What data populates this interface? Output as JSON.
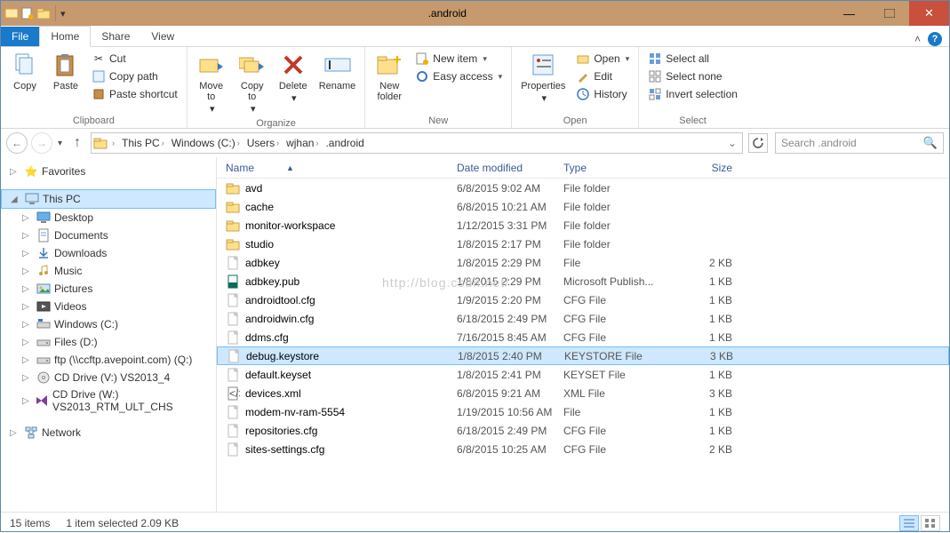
{
  "window": {
    "title": ".android"
  },
  "tabs": {
    "file": "File",
    "home": "Home",
    "share": "Share",
    "view": "View"
  },
  "ribbon": {
    "clipboard": {
      "copy": "Copy",
      "paste": "Paste",
      "cut": "Cut",
      "copypath": "Copy path",
      "pasteshortcut": "Paste shortcut",
      "label": "Clipboard"
    },
    "organize": {
      "moveto": "Move\nto",
      "copyto": "Copy\nto",
      "delete": "Delete",
      "rename": "Rename",
      "label": "Organize"
    },
    "new": {
      "newfolder": "New\nfolder",
      "newitem": "New item",
      "easyaccess": "Easy access",
      "label": "New"
    },
    "open": {
      "properties": "Properties",
      "open": "Open",
      "edit": "Edit",
      "history": "History",
      "label": "Open"
    },
    "select": {
      "selectall": "Select all",
      "selectnone": "Select none",
      "invert": "Invert selection",
      "label": "Select"
    }
  },
  "breadcrumbs": [
    "This PC",
    "Windows (C:)",
    "Users",
    "wjhan",
    ".android"
  ],
  "search": {
    "placeholder": "Search .android"
  },
  "columns": {
    "name": "Name",
    "date": "Date modified",
    "type": "Type",
    "size": "Size"
  },
  "nav": {
    "favorites": "Favorites",
    "thispc": "This PC",
    "items": [
      "Desktop",
      "Documents",
      "Downloads",
      "Music",
      "Pictures",
      "Videos",
      "Windows (C:)",
      "Files (D:)",
      "ftp (\\\\ccftp.avepoint.com) (Q:)",
      "CD Drive (V:) VS2013_4",
      "CD Drive (W:) VS2013_RTM_ULT_CHS"
    ],
    "network": "Network"
  },
  "files": [
    {
      "name": "avd",
      "date": "6/8/2015 9:02 AM",
      "type": "File folder",
      "size": "",
      "icon": "folder"
    },
    {
      "name": "cache",
      "date": "6/8/2015 10:21 AM",
      "type": "File folder",
      "size": "",
      "icon": "folder"
    },
    {
      "name": "monitor-workspace",
      "date": "1/12/2015 3:31 PM",
      "type": "File folder",
      "size": "",
      "icon": "folder"
    },
    {
      "name": "studio",
      "date": "1/8/2015 2:17 PM",
      "type": "File folder",
      "size": "",
      "icon": "folder"
    },
    {
      "name": "adbkey",
      "date": "1/8/2015 2:29 PM",
      "type": "File",
      "size": "2 KB",
      "icon": "file"
    },
    {
      "name": "adbkey.pub",
      "date": "1/8/2015 2:29 PM",
      "type": "Microsoft Publish...",
      "size": "1 KB",
      "icon": "pub"
    },
    {
      "name": "androidtool.cfg",
      "date": "1/9/2015 2:20 PM",
      "type": "CFG File",
      "size": "1 KB",
      "icon": "file"
    },
    {
      "name": "androidwin.cfg",
      "date": "6/18/2015 2:49 PM",
      "type": "CFG File",
      "size": "1 KB",
      "icon": "file"
    },
    {
      "name": "ddms.cfg",
      "date": "7/16/2015 8:45 AM",
      "type": "CFG File",
      "size": "1 KB",
      "icon": "file"
    },
    {
      "name": "debug.keystore",
      "date": "1/8/2015 2:40 PM",
      "type": "KEYSTORE File",
      "size": "3 KB",
      "icon": "file",
      "selected": true
    },
    {
      "name": "default.keyset",
      "date": "1/8/2015 2:41 PM",
      "type": "KEYSET File",
      "size": "1 KB",
      "icon": "file"
    },
    {
      "name": "devices.xml",
      "date": "6/8/2015 9:21 AM",
      "type": "XML File",
      "size": "3 KB",
      "icon": "xml"
    },
    {
      "name": "modem-nv-ram-5554",
      "date": "1/19/2015 10:56 AM",
      "type": "File",
      "size": "1 KB",
      "icon": "file"
    },
    {
      "name": "repositories.cfg",
      "date": "6/18/2015 2:49 PM",
      "type": "CFG File",
      "size": "1 KB",
      "icon": "file"
    },
    {
      "name": "sites-settings.cfg",
      "date": "6/8/2015 10:25 AM",
      "type": "CFG File",
      "size": "2 KB",
      "icon": "file"
    }
  ],
  "status": {
    "count": "15 items",
    "selected": "1 item selected  2.09 KB"
  },
  "watermark": "http://blog.csdn.net/"
}
